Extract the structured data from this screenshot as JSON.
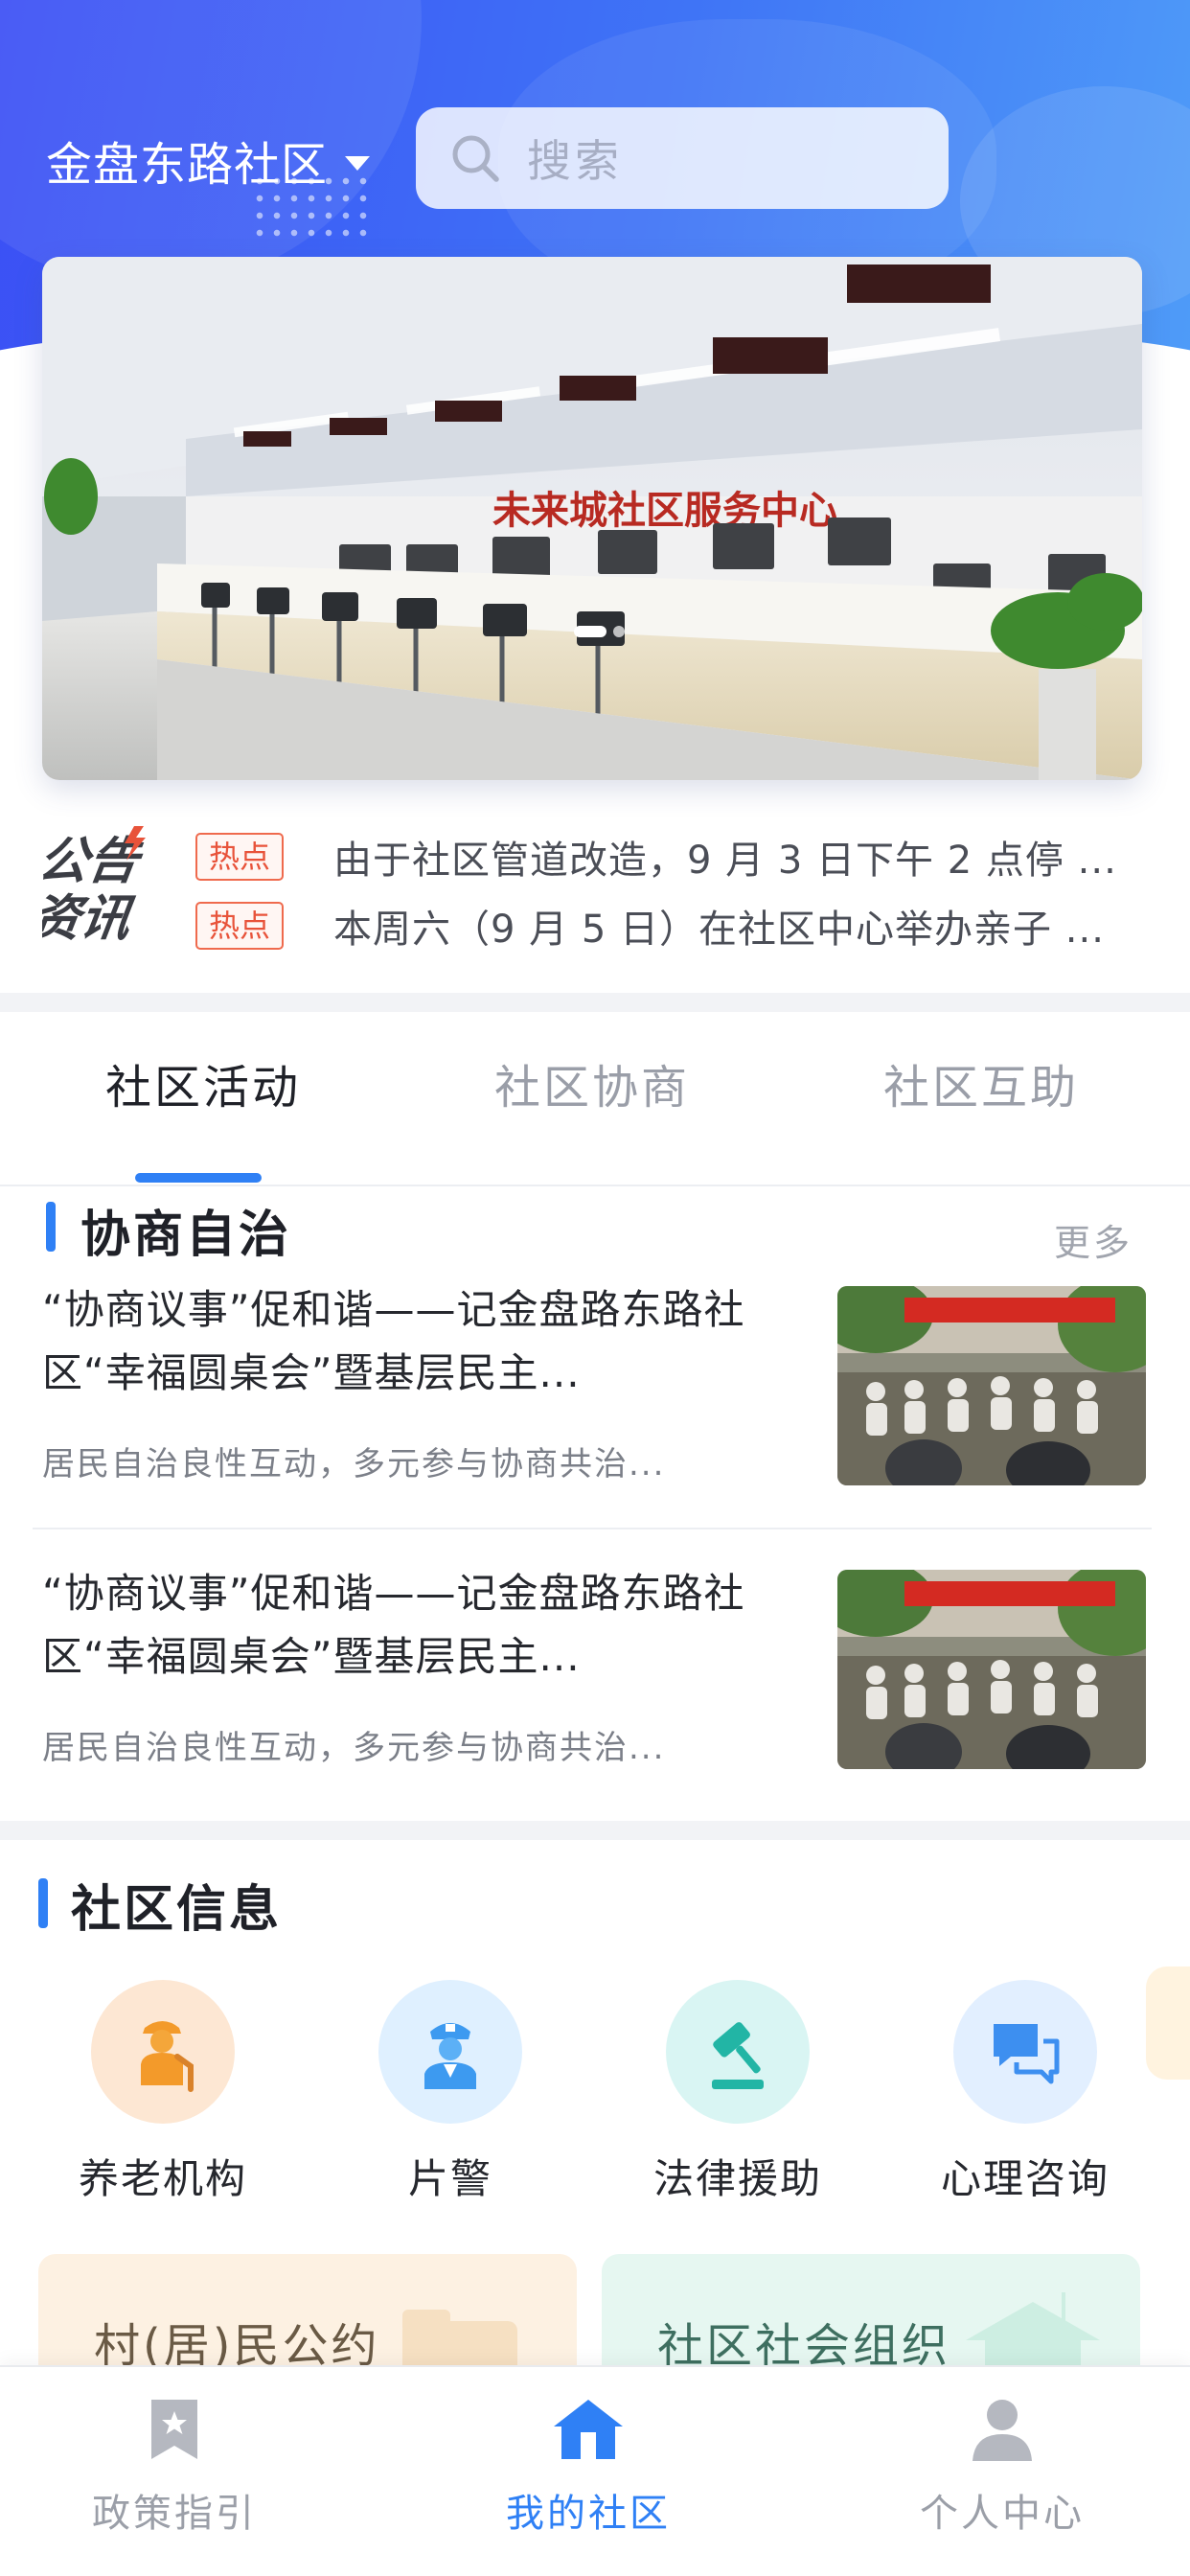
{
  "header": {
    "location": "金盘东路社区",
    "search_placeholder": "搜索"
  },
  "notices": {
    "logo_text": [
      "公告",
      "资讯"
    ],
    "items": [
      {
        "tag": "热点",
        "text": "由于社区管道改造，9 月 3 日下午 2 点停 ..."
      },
      {
        "tag": "热点",
        "text": "本周六（9 月 5 日）在社区中心举办亲子 ..."
      }
    ]
  },
  "tabs": [
    {
      "label": "社区活动",
      "active": true
    },
    {
      "label": "社区协商",
      "active": false
    },
    {
      "label": "社区互助",
      "active": false
    }
  ],
  "consultation": {
    "title": "协商自治",
    "more": "更多",
    "articles": [
      {
        "title": "“协商议事”促和谐——记金盘路东路社区“幸福圆桌会”暨基层民主...",
        "desc": "居民自治良性互动，多元参与协商共治..."
      },
      {
        "title": "“协商议事”促和谐——记金盘路东路社区“幸福圆桌会”暨基层民主...",
        "desc": "居民自治良性互动，多元参与协商共治..."
      }
    ]
  },
  "community_info": {
    "title": "社区信息",
    "items": [
      {
        "label": "养老机构",
        "icon": "elderly-icon",
        "bg": "#fde7d3"
      },
      {
        "label": "片警",
        "icon": "police-icon",
        "bg": "#dff0ff"
      },
      {
        "label": "法律援助",
        "icon": "gavel-icon",
        "bg": "#d9f5f3"
      },
      {
        "label": "心理咨询",
        "icon": "chat-icon",
        "bg": "#e2efff"
      }
    ],
    "cards": [
      {
        "label": "村(居)民公约",
        "bg": "#fdf1e2"
      },
      {
        "label": "社区社会组织",
        "bg": "#e6f7f1"
      }
    ]
  },
  "bottom_nav": [
    {
      "label": "政策指引",
      "icon": "bookmark-star-icon",
      "active": false
    },
    {
      "label": "我的社区",
      "icon": "home-icon",
      "active": true
    },
    {
      "label": "个人中心",
      "icon": "person-icon",
      "active": false
    }
  ],
  "colors": {
    "primary": "#2f80f5",
    "hot_tag": "#e8533a",
    "header_gradient_start": "#3b4ff5",
    "header_gradient_end": "#4f9cf8"
  }
}
